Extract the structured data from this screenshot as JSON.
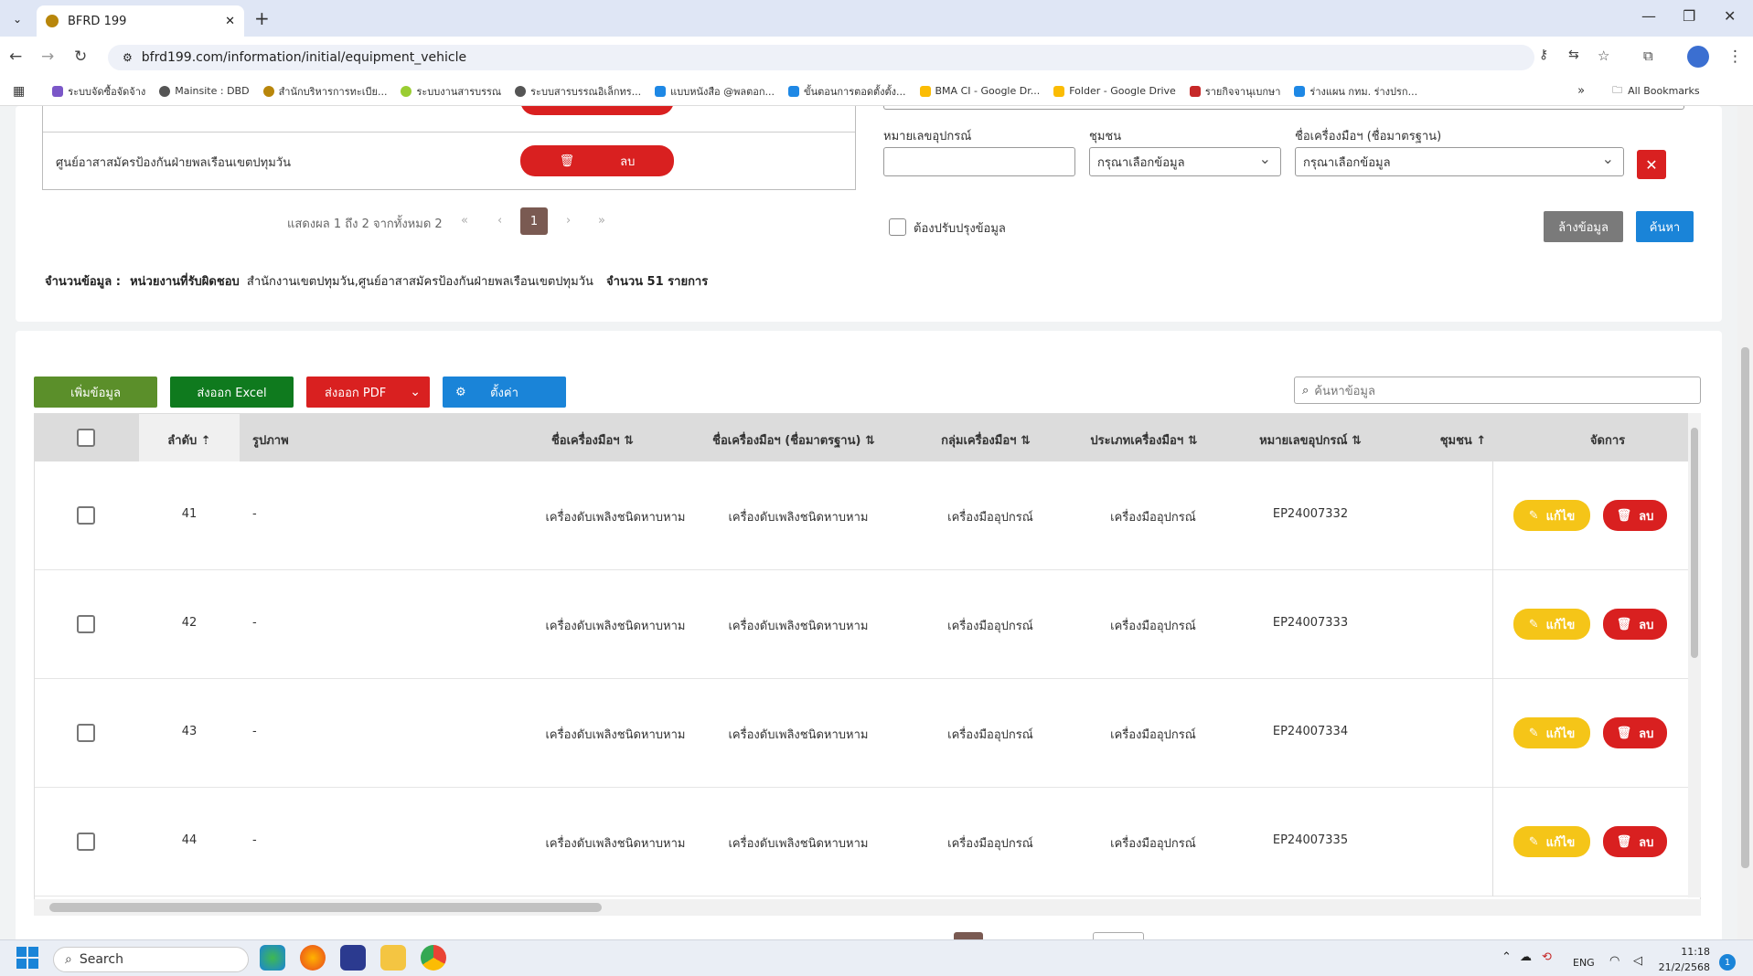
{
  "browser": {
    "tab_title": "BFRD 199",
    "url": "bfrd199.com/information/initial/equipment_vehicle",
    "bookmarks": [
      "ระบบจัดซื้อจัดจ้าง",
      "Mainsite : DBD",
      "สำนักบริหารการทะเบีย...",
      "ระบบงานสารบรรณ",
      "ระบบสารบรรณอิเล็กทร...",
      "แบบหนังสือ @พลตอก...",
      "ขั้นตอนการตอดตั้งตั้ง...",
      "BMA CI - Google Dr...",
      "Folder - Google Drive",
      "รายกิจจานุเบกษา",
      "ร่างแผน กทม. ร่างปรก..."
    ],
    "all_bookmarks": "All Bookmarks"
  },
  "left_table": {
    "row_label": "ศูนย์อาสาสมัครป้องกันฝ่ายพลเรือนเขตปทุมวัน",
    "delete_label": "ลบ"
  },
  "pager_top": {
    "summary": "แสดงผล 1 ถึง 2 จากทั้งหมด 2",
    "first": "«",
    "prev": "‹",
    "current": "1",
    "next": "›",
    "last": "»"
  },
  "filters": {
    "equipment_no_label": "หมายเลขอุปกรณ์",
    "equipment_no_value": "",
    "community_label": "ชุมชน",
    "community_placeholder": "กรุณาเลือกข้อมูล",
    "tool_name_label": "ชื่อเครื่องมือฯ (ชื่อมาตรฐาน)",
    "tool_name_placeholder": "กรุณาเลือกข้อมูล",
    "needs_update_label": "ต้องปรับปรุงข้อมูล",
    "clear_label": "ล้างข้อมูล",
    "search_label": "ค้นหา"
  },
  "summary": {
    "count_label": "จำนวนข้อมูล :",
    "unit_label": "หน่วยงานที่รับผิดชอบ",
    "units": "สำนักงานเขตปทุมวัน,ศูนย์อาสาสมัครป้องกันฝ่ายพลเรือนเขตปทุมวัน",
    "total": "จำนวน 51 รายการ"
  },
  "toolbar": {
    "add_label": "เพิ่มข้อมูล",
    "excel_label": "ส่งออก Excel",
    "pdf_label": "ส่งออก PDF",
    "settings_label": "ตั้งค่า",
    "search_placeholder": "ค้นหาข้อมูล"
  },
  "table": {
    "headers": {
      "order": "ลำดับ",
      "image": "รูปภาพ",
      "tool_name": "ชื่อเครื่องมือฯ",
      "tool_std": "ชื่อเครื่องมือฯ (ชื่อมาตรฐาน)",
      "tool_group": "กลุ่มเครื่องมือฯ",
      "tool_type": "ประเภทเครื่องมือฯ",
      "equip_no": "หมายเลขอุปกรณ์",
      "community": "ชุมชน",
      "manage": "จัดการ"
    },
    "edit_label": "แก้ไข",
    "delete_label": "ลบ",
    "rows": [
      {
        "order": "41",
        "image": "-",
        "tool_name": "เครื่องดับเพลิงชนิดหาบหาม",
        "tool_std": "เครื่องดับเพลิงชนิดหาบหาม",
        "tool_group": "เครื่องมืออุปกรณ์",
        "tool_type": "เครื่องมืออุปกรณ์",
        "equip_no": "EP24007332"
      },
      {
        "order": "42",
        "image": "-",
        "tool_name": "เครื่องดับเพลิงชนิดหาบหาม",
        "tool_std": "เครื่องดับเพลิงชนิดหาบหาม",
        "tool_group": "เครื่องมืออุปกรณ์",
        "tool_type": "เครื่องมืออุปกรณ์",
        "equip_no": "EP24007333"
      },
      {
        "order": "43",
        "image": "-",
        "tool_name": "เครื่องดับเพลิงชนิดหาบหาม",
        "tool_std": "เครื่องดับเพลิงชนิดหาบหาม",
        "tool_group": "เครื่องมืออุปกรณ์",
        "tool_type": "เครื่องมืออุปกรณ์",
        "equip_no": "EP24007334"
      },
      {
        "order": "44",
        "image": "-",
        "tool_name": "เครื่องดับเพลิงชนิดหาบหาม",
        "tool_std": "เครื่องดับเพลิงชนิดหาบหาม",
        "tool_group": "เครื่องมืออุปกรณ์",
        "tool_type": "เครื่องมืออุปกรณ์",
        "equip_no": "EP24007335"
      }
    ]
  },
  "taskbar": {
    "search_label": "Search",
    "lang": "ENG",
    "time": "11:18",
    "date": "21/2/2568",
    "notif_count": "1"
  },
  "colors": {
    "red": "#d92020",
    "green_dark": "#0f7a1e",
    "green_add": "#5b8f2a",
    "blue": "#1a84d8",
    "yellow": "#f5c518",
    "gray_btn": "#7a7a7a"
  }
}
